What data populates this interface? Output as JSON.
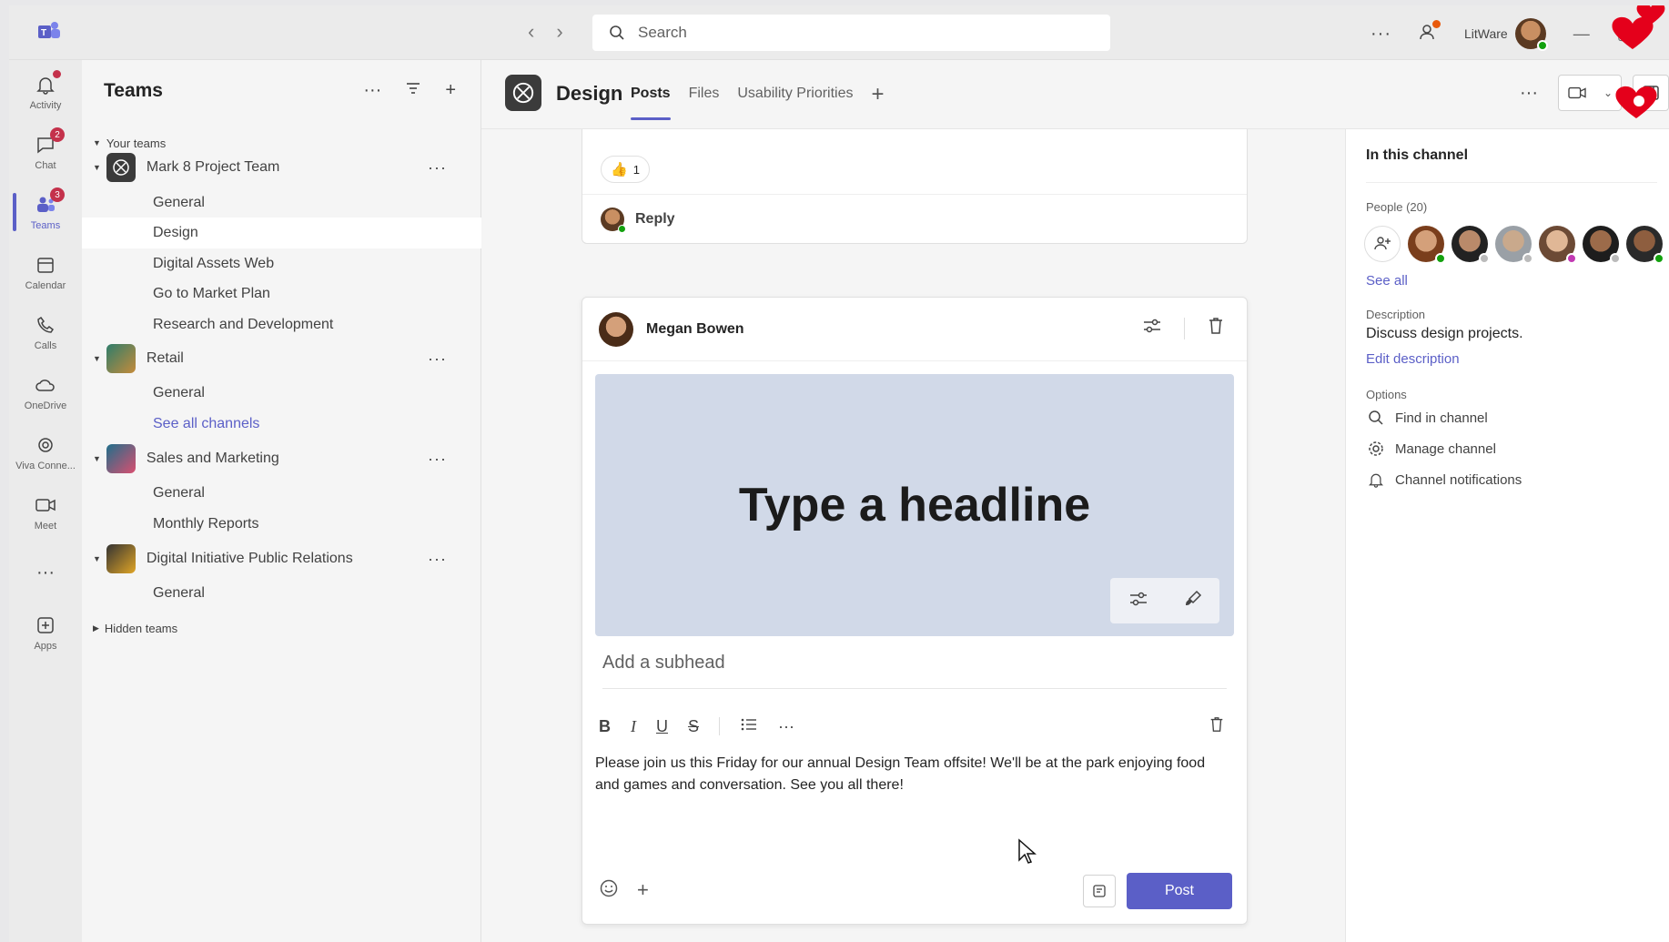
{
  "titlebar": {
    "search_placeholder": "Search",
    "more": "···",
    "org_name": "LitWare"
  },
  "rail": {
    "items": [
      {
        "label": "Activity",
        "icon": "bell-icon"
      },
      {
        "label": "Chat",
        "icon": "chat-icon",
        "badge": "2"
      },
      {
        "label": "Teams",
        "icon": "teams-icon",
        "badge": "3"
      },
      {
        "label": "Calendar",
        "icon": "calendar-icon"
      },
      {
        "label": "Calls",
        "icon": "phone-icon"
      },
      {
        "label": "OneDrive",
        "icon": "cloud-icon"
      },
      {
        "label": "Viva Conne...",
        "icon": "viva-icon"
      },
      {
        "label": "Meet",
        "icon": "video-icon"
      },
      {
        "label": "···",
        "icon": "more-icon"
      },
      {
        "label": "Apps",
        "icon": "apps-icon"
      }
    ]
  },
  "teams_panel": {
    "title": "Teams",
    "your_teams": "Your teams",
    "hidden_teams": "Hidden teams",
    "teams": [
      {
        "name": "Mark 8 Project Team",
        "channels": [
          "General",
          "Design",
          "Digital Assets Web",
          "Go to Market Plan",
          "Research and Development"
        ]
      },
      {
        "name": "Retail",
        "channels": [
          "General"
        ],
        "see_all": "See all channels"
      },
      {
        "name": "Sales and Marketing",
        "channels": [
          "General",
          "Monthly Reports"
        ]
      },
      {
        "name": "Digital Initiative Public Relations",
        "channels": [
          "General"
        ]
      }
    ]
  },
  "channel": {
    "name": "Design",
    "tabs": [
      "Posts",
      "Files",
      "Usability Priorities"
    ],
    "active_tab": "Posts"
  },
  "previous_post": {
    "reaction_count": "1",
    "reply_label": "Reply"
  },
  "composer": {
    "author": "Megan Bowen",
    "headline": "Type a headline",
    "subhead_placeholder": "Add a subhead",
    "body": "Please join us this Friday for our annual Design Team offsite! We'll be at the park enjoying food and games and conversation. See you all there!",
    "post_label": "Post",
    "format": {
      "bold": "B",
      "italic": "I",
      "underline": "U",
      "strike": "S",
      "more": "···"
    }
  },
  "details": {
    "title": "In this channel",
    "people_label": "People (20)",
    "see_all": "See all",
    "description_label": "Description",
    "description": "Discuss design projects.",
    "edit_description": "Edit description",
    "options_label": "Options",
    "options": [
      "Find in channel",
      "Manage channel",
      "Channel notifications"
    ]
  },
  "colors": {
    "brand": "#5b5fc7",
    "badge": "#c4314b",
    "presence_available": "#13a10e",
    "hero_bg": "#d1d9e8"
  }
}
